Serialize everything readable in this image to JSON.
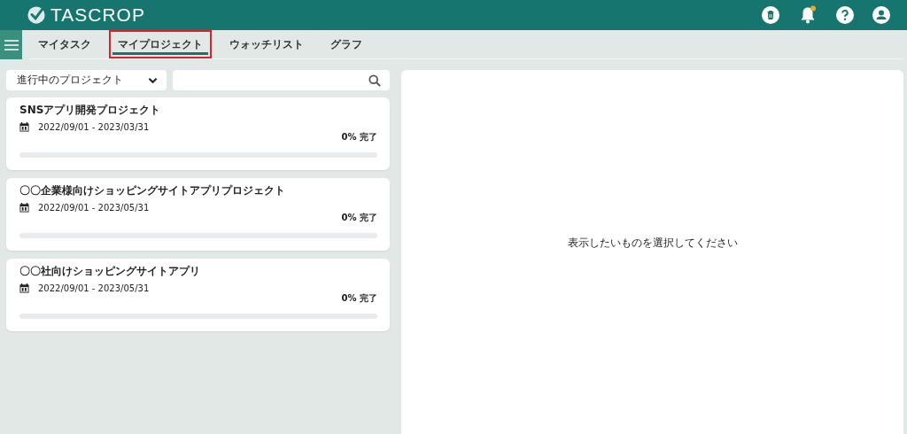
{
  "header": {
    "logo": "TASCROP",
    "notification_badge": true
  },
  "tabs": [
    {
      "label": "マイタスク",
      "selected": false,
      "highlighted": false
    },
    {
      "label": "マイプロジェクト",
      "selected": true,
      "highlighted": true
    },
    {
      "label": "ウォッチリスト",
      "selected": false,
      "highlighted": false
    },
    {
      "label": "グラフ",
      "selected": false,
      "highlighted": false
    }
  ],
  "filter": {
    "value": "進行中のプロジェクト"
  },
  "projects": [
    {
      "name": "SNSアプリ開発プロジェクト",
      "period": "2022/09/01 - 2023/03/31",
      "progress": "0% 完了",
      "level": 0
    },
    {
      "name": "〇〇企業様向けショッピングサイトアプリプロジェクト",
      "period": "2022/09/01 - 2023/05/31",
      "progress": "0% 完了",
      "level": 0
    },
    {
      "name": "〇〇社向けショッピングサイトアプリ",
      "period": "2022/09/01 - 2023/05/31",
      "progress": "0% 完了",
      "level": 0
    }
  ],
  "detail": {
    "message": "表示したいものを選択してください"
  }
}
